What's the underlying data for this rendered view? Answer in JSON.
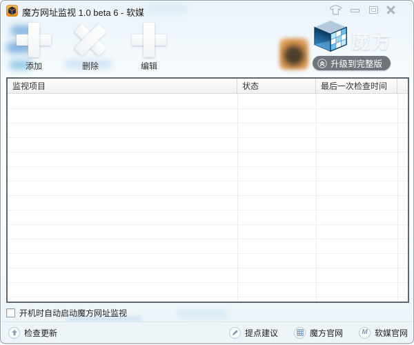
{
  "window": {
    "title": "魔方网址监视 1.0 beta 6 - 软媒"
  },
  "toolbar": {
    "buttons": [
      {
        "label": "添加",
        "icon": "plus-icon"
      },
      {
        "label": "删除",
        "icon": "cross-icon"
      },
      {
        "label": "编辑",
        "icon": "plus-icon"
      }
    ]
  },
  "brand": {
    "logo_text": "魔方",
    "upgrade_label": "升级到完整版"
  },
  "table": {
    "columns": [
      "监视项目",
      "状态",
      "最后一次检查时间"
    ],
    "rows": []
  },
  "options": {
    "autostart_label": "开机时自动启动魔方网址监视",
    "autostart_checked": false
  },
  "statusbar": {
    "items": [
      {
        "label": "检查更新",
        "icon": "arrow-up-circle-icon"
      },
      {
        "label": "提点建议",
        "icon": "pencil-circle-icon"
      },
      {
        "label": "魔方官网",
        "icon": "grid-circle-icon"
      },
      {
        "label": "软媒官网",
        "icon": "m-circle-icon",
        "icon_letter": "M"
      }
    ]
  },
  "colors": {
    "cube_blue": "#2f86c4",
    "cube_dark": "#0d3f66",
    "app_icon_orange": "#f09a2c",
    "upgrade_pill_bg": "rgba(73,79,85,0.78)",
    "statusbar_bg": "#edf5f9",
    "grid_icon_blue": "#5b8db8"
  }
}
